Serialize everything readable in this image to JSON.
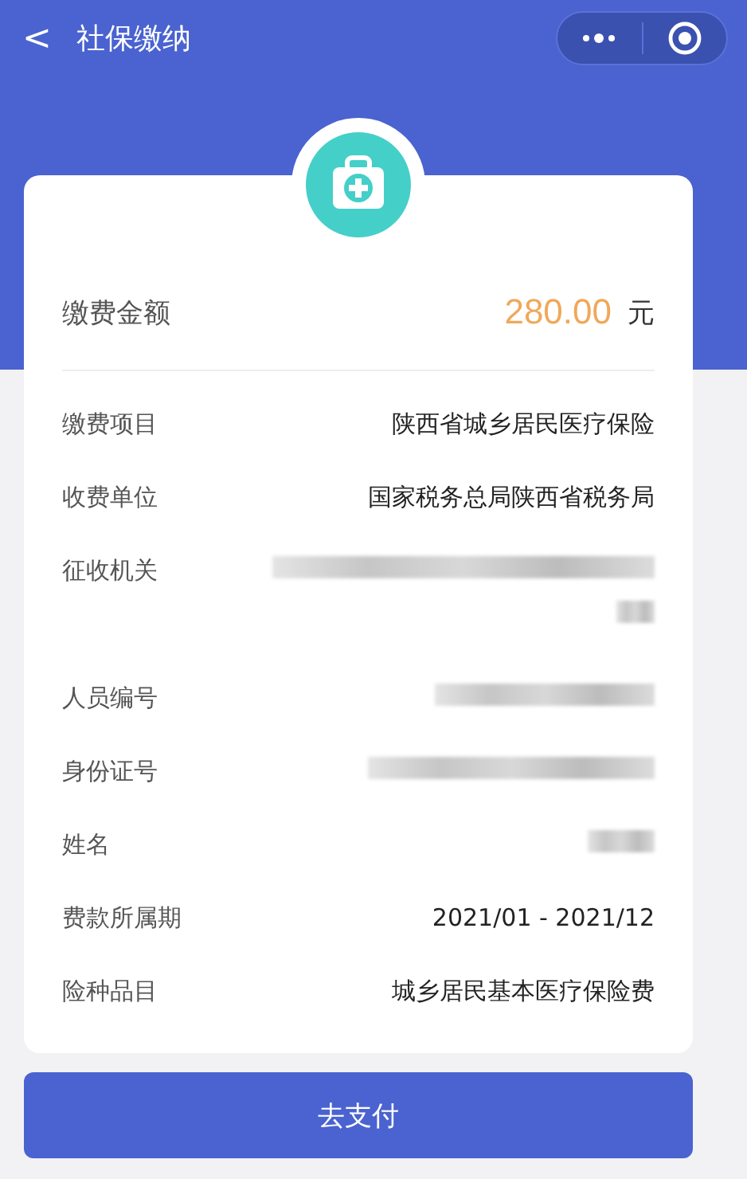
{
  "nav": {
    "back": "<",
    "title": "社保缴纳"
  },
  "amount": {
    "label": "缴费金额",
    "value": "280.00",
    "unit": "元"
  },
  "rows": [
    {
      "kind": "text",
      "label": "缴费项目",
      "value": "陕西省城乡居民医疗保险"
    },
    {
      "kind": "text",
      "label": "收费单位",
      "value": "国家税务总局陕西省税务局"
    },
    {
      "kind": "redacted",
      "label": "征收机关"
    },
    {
      "kind": "redacted",
      "label": "人员编号"
    },
    {
      "kind": "redacted",
      "label": "身份证号"
    },
    {
      "kind": "redacted",
      "label": "姓名"
    },
    {
      "kind": "text",
      "label": "费款所属期",
      "value": "2021/01 - 2021/12"
    },
    {
      "kind": "text",
      "label": "险种品目",
      "value": "城乡居民基本医疗保险费"
    }
  ],
  "pay_button": "去支付"
}
